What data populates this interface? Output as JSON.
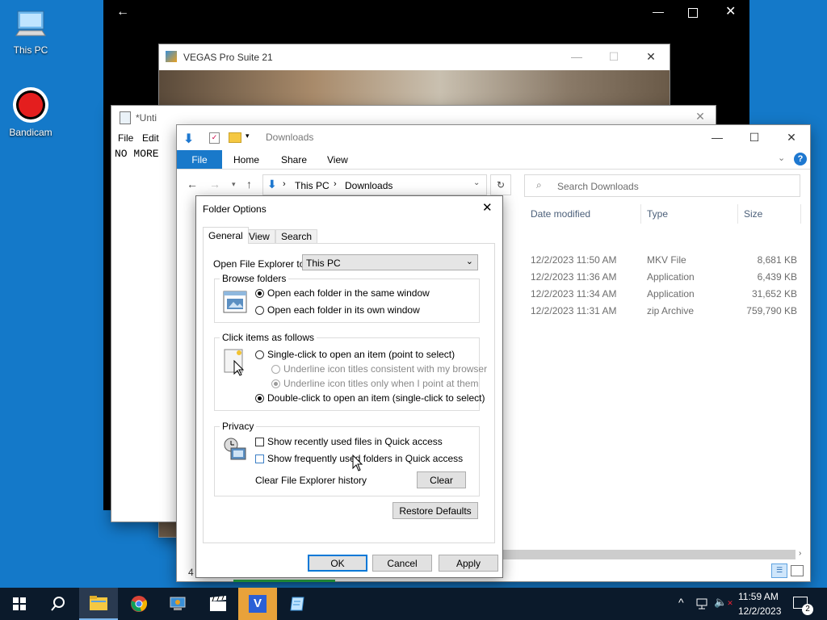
{
  "desktop": {
    "icons": [
      {
        "label": "This PC",
        "icon": "computer-icon"
      },
      {
        "label": "Bandicam",
        "icon": "record-icon"
      }
    ]
  },
  "notepad": {
    "title": "*Unti",
    "menu_file": "File",
    "menu_edit": "Edit",
    "content": "NO MORE"
  },
  "vegas": {
    "title": "VEGAS Pro Suite 21"
  },
  "explorer": {
    "title": "Downloads",
    "ribbon_tabs": {
      "file": "File",
      "home": "Home",
      "share": "Share",
      "view": "View"
    },
    "breadcrumb": {
      "root": "This PC",
      "current": "Downloads"
    },
    "search_placeholder": "Search Downloads",
    "columns": {
      "date": "Date modified",
      "type": "Type",
      "size": "Size"
    },
    "rows": [
      {
        "date": "12/2/2023 11:50 AM",
        "type": "MKV File",
        "size": "8,681 KB"
      },
      {
        "date": "12/2/2023 11:36 AM",
        "type": "Application",
        "size": "6,439 KB"
      },
      {
        "date": "12/2/2023 11:34 AM",
        "type": "Application",
        "size": "31,652 KB"
      },
      {
        "date": "12/2/2023 11:31 AM",
        "type": "zip Archive",
        "size": "759,790 KB"
      }
    ],
    "status_count": "4"
  },
  "dialog": {
    "title": "Folder Options",
    "tabs": {
      "general": "General",
      "view": "View",
      "search": "Search"
    },
    "open_to_label": "Open File Explorer to:",
    "open_to_value": "This PC",
    "browse": {
      "legend": "Browse folders",
      "same_window": "Open each folder in the same window",
      "own_window": "Open each folder in its own window"
    },
    "click": {
      "legend": "Click items as follows",
      "single": "Single-click to open an item (point to select)",
      "underline_consistent": "Underline icon titles consistent with my browser",
      "underline_point": "Underline icon titles only when I point at them",
      "double": "Double-click to open an item (single-click to select)"
    },
    "privacy": {
      "legend": "Privacy",
      "recent_files": "Show recently used files in Quick access",
      "frequent_folders": "Show frequently used folders in Quick access",
      "clear_label": "Clear File Explorer history",
      "clear_button": "Clear"
    },
    "restore_defaults": "Restore Defaults",
    "ok": "OK",
    "cancel": "Cancel",
    "apply": "Apply"
  },
  "taskbar": {
    "time": "11:59 AM",
    "date": "12/2/2023",
    "notification_count": "2"
  },
  "colors": {
    "desktop": "#1479c9",
    "taskbar": "#0b1a2b",
    "accent": "#0063b1"
  }
}
